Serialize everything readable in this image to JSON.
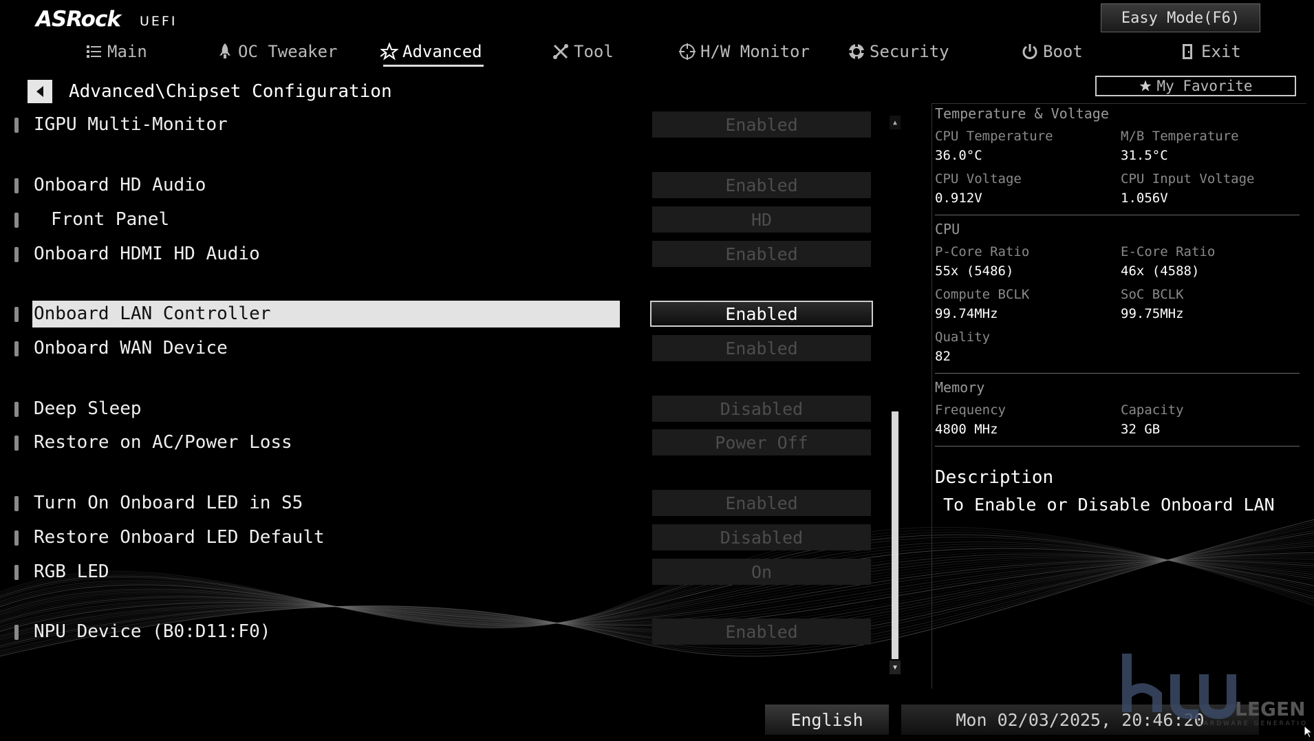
{
  "header": {
    "brand": "ASRock",
    "brand_sub": "UEFI",
    "easy_mode_label": "Easy Mode(F6)",
    "my_favorite_label": "My Favorite"
  },
  "nav": {
    "tabs": [
      {
        "label": "Main",
        "icon": "list-icon"
      },
      {
        "label": "OC Tweaker",
        "icon": "rocket-icon"
      },
      {
        "label": "Advanced",
        "icon": "star-icon",
        "active": true
      },
      {
        "label": "Tool",
        "icon": "tools-icon"
      },
      {
        "label": "H/W Monitor",
        "icon": "crosshair-icon"
      },
      {
        "label": "Security",
        "icon": "shield-icon"
      },
      {
        "label": "Boot",
        "icon": "power-icon"
      },
      {
        "label": "Exit",
        "icon": "exit-door-icon"
      }
    ]
  },
  "breadcrumb": "Advanced\\Chipset Configuration",
  "settings": [
    {
      "label": "IGPU Multi-Monitor",
      "value": "Enabled"
    },
    {
      "label": "Onboard HD Audio",
      "value": "Enabled"
    },
    {
      "label": "Front Panel",
      "value": "HD",
      "indent": true
    },
    {
      "label": "Onboard HDMI HD Audio",
      "value": "Enabled"
    },
    {
      "label": "Onboard LAN Controller",
      "value": "Enabled",
      "selected": true
    },
    {
      "label": "Onboard WAN Device",
      "value": "Enabled"
    },
    {
      "label": "Deep Sleep",
      "value": "Disabled"
    },
    {
      "label": "Restore on AC/Power Loss",
      "value": "Power Off"
    },
    {
      "label": "Turn On Onboard LED in S5",
      "value": "Enabled"
    },
    {
      "label": "Restore Onboard LED Default",
      "value": "Disabled"
    },
    {
      "label": "RGB LED",
      "value": "On"
    },
    {
      "label": "NPU Device (B0:D11:F0)",
      "value": "Enabled"
    }
  ],
  "info_panel": {
    "temp_voltage": {
      "title": "Temperature & Voltage",
      "cpu_temp_label": "CPU Temperature",
      "cpu_temp": "36.0°C",
      "mb_temp_label": "M/B Temperature",
      "mb_temp": "31.5°C",
      "cpu_voltage_label": "CPU Voltage",
      "cpu_voltage": "0.912V",
      "cpu_input_voltage_label": "CPU Input Voltage",
      "cpu_input_voltage": "1.056V"
    },
    "cpu": {
      "title": "CPU",
      "pcore_label": "P-Core Ratio",
      "pcore": "55x (5486)",
      "ecore_label": "E-Core Ratio",
      "ecore": "46x (4588)",
      "compute_bclk_label": "Compute BCLK",
      "compute_bclk": "99.74MHz",
      "soc_bclk_label": "SoC BCLK",
      "soc_bclk": "99.75MHz",
      "quality_label": "Quality",
      "quality": "82"
    },
    "memory": {
      "title": "Memory",
      "frequency_label": "Frequency",
      "frequency": "4800 MHz",
      "capacity_label": "Capacity",
      "capacity": "32 GB"
    },
    "description": {
      "title": "Description",
      "text": "To Enable or Disable Onboard LAN"
    }
  },
  "footer": {
    "language": "English",
    "datetime": "Mon 02/03/2025, 20:46:20"
  },
  "watermark": {
    "text": "LEGEND",
    "sub": "HARDWARE GENERATION"
  },
  "colors": {
    "background": "#000000",
    "selected_row": "#e3e3e3",
    "disabled_value_text": "#4d4d4d"
  }
}
